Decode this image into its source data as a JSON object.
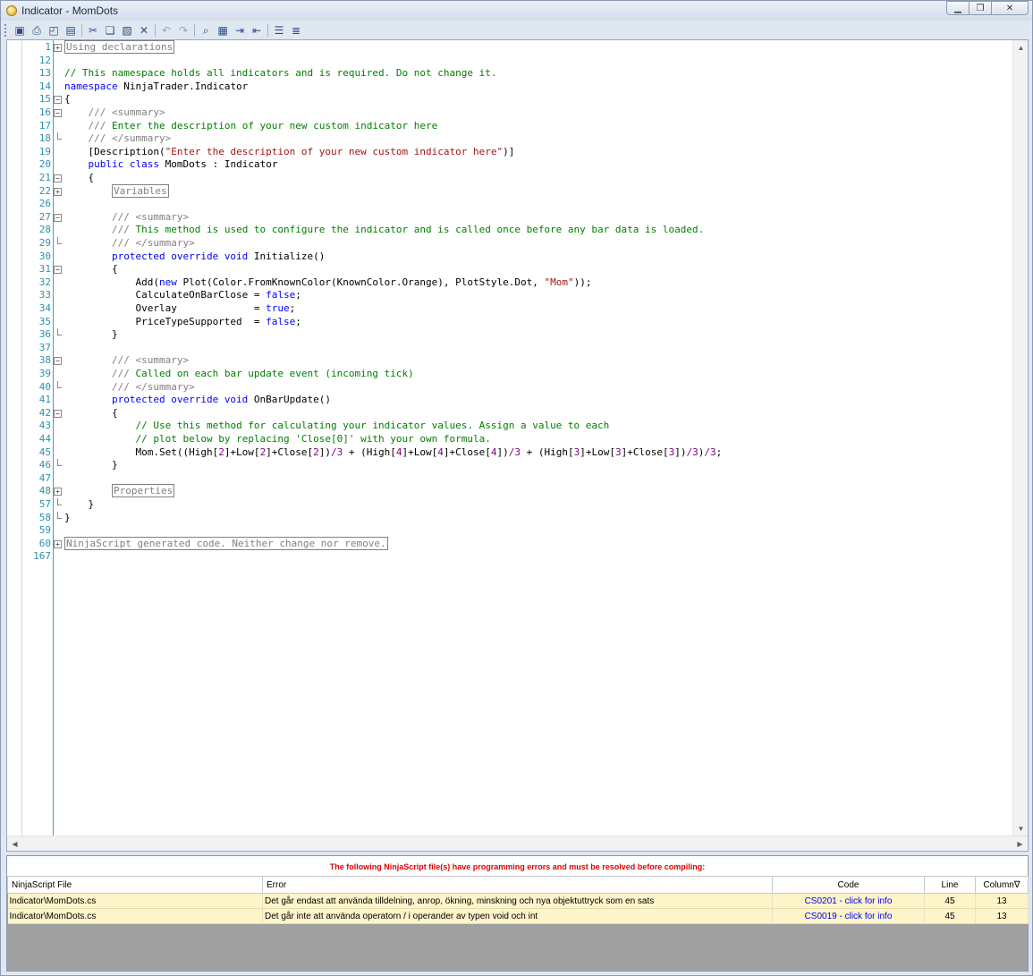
{
  "window": {
    "title": "Indicator - MomDots",
    "controls": [
      "minimize",
      "restore",
      "close"
    ]
  },
  "toolbar": [
    "save-icon",
    "print-icon",
    "print-preview-icon",
    "page-setup-icon",
    "cut-icon",
    "copy-icon",
    "paste-icon",
    "delete-icon",
    "undo-icon",
    "redo-icon",
    "find-icon",
    "find-replace-icon",
    "indent-icon",
    "outdent-icon",
    "comment-icon",
    "uncomment-icon"
  ],
  "code": [
    {
      "n": "1",
      "fold": "plus",
      "t": [
        {
          "c": "box",
          "s": "Using declarations"
        }
      ]
    },
    {
      "n": "12",
      "t": []
    },
    {
      "n": "13",
      "t": [
        {
          "c": "cm",
          "s": "// This namespace holds all indicators and is required. Do not change it."
        }
      ]
    },
    {
      "n": "14",
      "t": [
        {
          "c": "kw",
          "s": "namespace"
        },
        {
          "s": " NinjaTrader.Indicator"
        }
      ]
    },
    {
      "n": "15",
      "fold": "minus",
      "t": [
        {
          "s": "{"
        }
      ]
    },
    {
      "n": "16",
      "fold": "minus",
      "t": [
        {
          "s": "    "
        },
        {
          "c": "cg",
          "s": "///"
        },
        {
          "c": "cm",
          "s": " "
        },
        {
          "c": "cg",
          "s": "<summary>"
        }
      ]
    },
    {
      "n": "17",
      "t": [
        {
          "s": "    "
        },
        {
          "c": "cg",
          "s": "///"
        },
        {
          "c": "cm",
          "s": " Enter the description of your new custom indicator here"
        }
      ]
    },
    {
      "n": "18",
      "fold": "end",
      "t": [
        {
          "s": "    "
        },
        {
          "c": "cg",
          "s": "///"
        },
        {
          "c": "cm",
          "s": " "
        },
        {
          "c": "cg",
          "s": "</summary>"
        }
      ]
    },
    {
      "n": "19",
      "t": [
        {
          "s": "    [Description("
        },
        {
          "c": "st",
          "s": "\"Enter the description of your new custom indicator here\""
        },
        {
          "s": ")]"
        }
      ]
    },
    {
      "n": "20",
      "t": [
        {
          "s": "    "
        },
        {
          "c": "kw",
          "s": "public class"
        },
        {
          "s": " MomDots : Indicator"
        }
      ]
    },
    {
      "n": "21",
      "fold": "minus",
      "t": [
        {
          "s": "    {"
        }
      ]
    },
    {
      "n": "22",
      "fold": "plus",
      "t": [
        {
          "s": "        "
        },
        {
          "c": "box",
          "s": "Variables"
        }
      ]
    },
    {
      "n": "26",
      "t": []
    },
    {
      "n": "27",
      "fold": "minus",
      "t": [
        {
          "s": "        "
        },
        {
          "c": "cg",
          "s": "///"
        },
        {
          "c": "cm",
          "s": " "
        },
        {
          "c": "cg",
          "s": "<summary>"
        }
      ]
    },
    {
      "n": "28",
      "t": [
        {
          "s": "        "
        },
        {
          "c": "cg",
          "s": "///"
        },
        {
          "c": "cm",
          "s": " This method is used to configure the indicator and is called once before any bar data is loaded."
        }
      ]
    },
    {
      "n": "29",
      "fold": "end",
      "t": [
        {
          "s": "        "
        },
        {
          "c": "cg",
          "s": "///"
        },
        {
          "c": "cm",
          "s": " "
        },
        {
          "c": "cg",
          "s": "</summary>"
        }
      ]
    },
    {
      "n": "30",
      "t": [
        {
          "s": "        "
        },
        {
          "c": "kw",
          "s": "protected override void"
        },
        {
          "s": " Initialize()"
        }
      ]
    },
    {
      "n": "31",
      "fold": "minus",
      "t": [
        {
          "s": "        {"
        }
      ]
    },
    {
      "n": "32",
      "t": [
        {
          "s": "            Add("
        },
        {
          "c": "kw",
          "s": "new"
        },
        {
          "s": " Plot(Color.FromKnownColor(KnownColor.Orange), PlotStyle.Dot, "
        },
        {
          "c": "st",
          "s": "\"Mom\""
        },
        {
          "s": "));"
        }
      ]
    },
    {
      "n": "33",
      "t": [
        {
          "s": "            CalculateOnBarClose = "
        },
        {
          "c": "kw",
          "s": "false"
        },
        {
          "s": ";"
        }
      ]
    },
    {
      "n": "34",
      "t": [
        {
          "s": "            Overlay             = "
        },
        {
          "c": "kw",
          "s": "true"
        },
        {
          "s": ";"
        }
      ]
    },
    {
      "n": "35",
      "t": [
        {
          "s": "            PriceTypeSupported  = "
        },
        {
          "c": "kw",
          "s": "false"
        },
        {
          "s": ";"
        }
      ]
    },
    {
      "n": "36",
      "fold": "end",
      "t": [
        {
          "s": "        }"
        }
      ]
    },
    {
      "n": "37",
      "t": []
    },
    {
      "n": "38",
      "fold": "minus",
      "t": [
        {
          "s": "        "
        },
        {
          "c": "cg",
          "s": "///"
        },
        {
          "c": "cm",
          "s": " "
        },
        {
          "c": "cg",
          "s": "<summary>"
        }
      ]
    },
    {
      "n": "39",
      "t": [
        {
          "s": "        "
        },
        {
          "c": "cg",
          "s": "///"
        },
        {
          "c": "cm",
          "s": " Called on each bar update event (incoming tick)"
        }
      ]
    },
    {
      "n": "40",
      "fold": "end",
      "t": [
        {
          "s": "        "
        },
        {
          "c": "cg",
          "s": "///"
        },
        {
          "c": "cm",
          "s": " "
        },
        {
          "c": "cg",
          "s": "</summary>"
        }
      ]
    },
    {
      "n": "41",
      "t": [
        {
          "s": "        "
        },
        {
          "c": "kw",
          "s": "protected override void"
        },
        {
          "s": " OnBarUpdate()"
        }
      ]
    },
    {
      "n": "42",
      "fold": "minus",
      "t": [
        {
          "s": "        {"
        }
      ]
    },
    {
      "n": "43",
      "t": [
        {
          "s": "            "
        },
        {
          "c": "cm",
          "s": "// Use this method for calculating your indicator values. Assign a value to each"
        }
      ]
    },
    {
      "n": "44",
      "t": [
        {
          "s": "            "
        },
        {
          "c": "cm",
          "s": "// plot below by replacing 'Close[0]' with your own formula."
        }
      ]
    },
    {
      "n": "45",
      "t": [
        {
          "s": "            Mom.Set((High["
        },
        {
          "c": "nm",
          "s": "2"
        },
        {
          "s": "]+Low["
        },
        {
          "c": "nm",
          "s": "2"
        },
        {
          "s": "]+Close["
        },
        {
          "c": "nm",
          "s": "2"
        },
        {
          "s": "])"
        },
        {
          "c": "nm",
          "s": "/3"
        },
        {
          "s": " + (High["
        },
        {
          "c": "nm",
          "s": "4"
        },
        {
          "s": "]+Low["
        },
        {
          "c": "nm",
          "s": "4"
        },
        {
          "s": "]+Close["
        },
        {
          "c": "nm",
          "s": "4"
        },
        {
          "s": "])"
        },
        {
          "c": "nm",
          "s": "/3"
        },
        {
          "s": " + (High["
        },
        {
          "c": "nm",
          "s": "3"
        },
        {
          "s": "]+Low["
        },
        {
          "c": "nm",
          "s": "3"
        },
        {
          "s": "]+Close["
        },
        {
          "c": "nm",
          "s": "3"
        },
        {
          "s": "])"
        },
        {
          "c": "nm",
          "s": "/3"
        },
        {
          "s": ")"
        },
        {
          "c": "nm",
          "s": "/3"
        },
        {
          "s": ";"
        }
      ]
    },
    {
      "n": "46",
      "fold": "end",
      "t": [
        {
          "s": "        }"
        }
      ]
    },
    {
      "n": "47",
      "t": []
    },
    {
      "n": "48",
      "fold": "plus",
      "t": [
        {
          "s": "        "
        },
        {
          "c": "box",
          "s": "Properties"
        }
      ]
    },
    {
      "n": "57",
      "fold": "end",
      "t": [
        {
          "s": "    }"
        }
      ]
    },
    {
      "n": "58",
      "fold": "end",
      "t": [
        {
          "s": "}"
        }
      ]
    },
    {
      "n": "59",
      "t": []
    },
    {
      "n": "60",
      "fold": "plus",
      "t": [
        {
          "c": "box",
          "s": "NinjaScript generated code. Neither change nor remove."
        }
      ]
    },
    {
      "n": "167",
      "t": []
    }
  ],
  "errors": {
    "message": "The following NinjaScript file(s) have programming errors and must be resolved before compiling:",
    "columns": {
      "file": "NinjaScript File",
      "error": "Error",
      "code": "Code",
      "line": "Line",
      "column": "Column"
    },
    "sort_indicator": "∇",
    "rows": [
      {
        "file": "Indicator\\MomDots.cs",
        "error": "Det går endast att använda tilldelning, anrop, ökning, minskning och nya objektuttryck som en sats",
        "code": "CS0201 - click for info",
        "line": "45",
        "column": "13"
      },
      {
        "file": "Indicator\\MomDots.cs",
        "error": "Det går inte att använda operatorn / i operander av typen void och int",
        "code": "CS0019 - click for info",
        "line": "45",
        "column": "13"
      }
    ]
  }
}
